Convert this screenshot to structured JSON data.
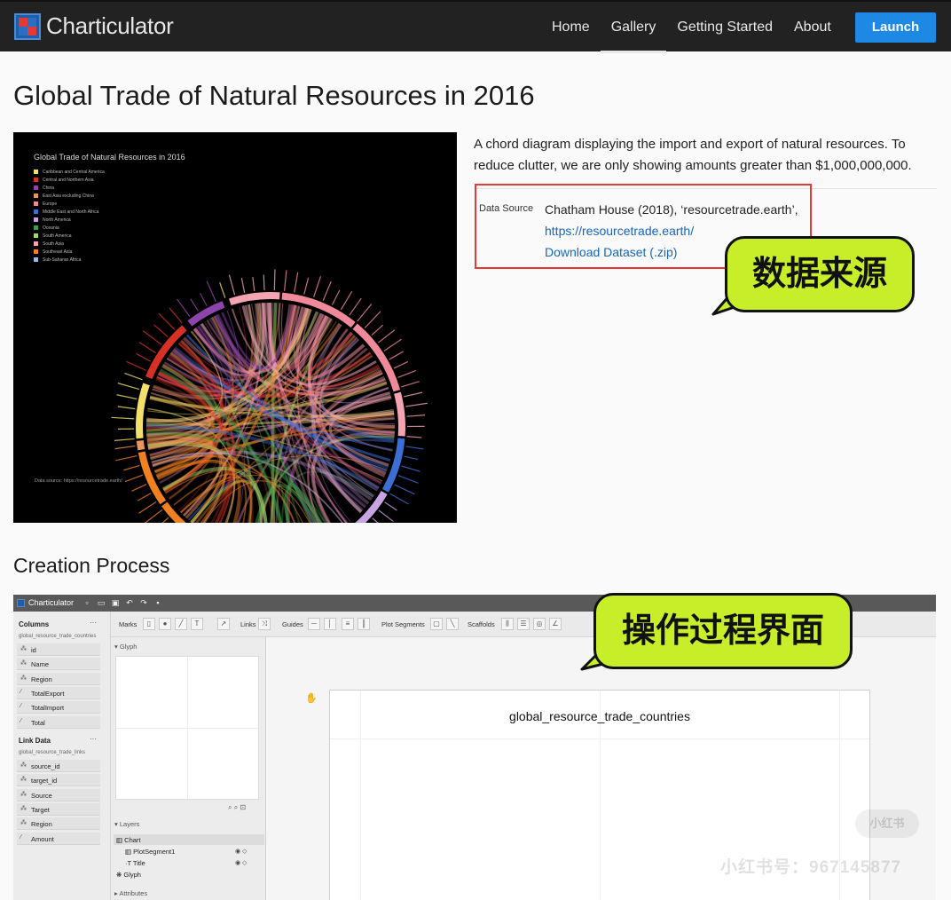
{
  "nav": {
    "brand": "Charticulator",
    "links": [
      "Home",
      "Gallery",
      "Getting Started",
      "About"
    ],
    "active": "Gallery",
    "launch": "Launch",
    "colors": {
      "bar": "#222222",
      "launch": "#1e88e5"
    }
  },
  "page": {
    "title": "Global Trade of Natural Resources in 2016",
    "description": "A chord diagram displaying the import and export of natural resources. To reduce clutter, we are only showing amounts greater than $1,000,000,000.",
    "data_source": {
      "label": "Data Source",
      "value": "Chatham House (2018), ‘resourcetrade.earth’,",
      "link": "https://resourcetrade.earth/",
      "download": "Download Dataset (.zip)"
    },
    "section_title": "Creation Process"
  },
  "annotations": {
    "data_source_callout": "数据来源",
    "process_callout": "操作过程界面",
    "callout_color": "#c8ee2a",
    "highlight_color": "#e53935"
  },
  "preview": {
    "title": "Global Trade of Natural Resources in 2016",
    "legend": [
      {
        "label": "Caribbean and Central America",
        "color": "#f2e06b"
      },
      {
        "label": "Central and Northern Asia",
        "color": "#d73027"
      },
      {
        "label": "China",
        "color": "#8e44ad"
      },
      {
        "label": "East Asia excluding China",
        "color": "#e8965c"
      },
      {
        "label": "Europe",
        "color": "#f08a9a"
      },
      {
        "label": "Middle East and North Africa",
        "color": "#3b6fd6"
      },
      {
        "label": "North America",
        "color": "#c9a4e4"
      },
      {
        "label": "Oceania",
        "color": "#3aa04a"
      },
      {
        "label": "South America",
        "color": "#a6d96a"
      },
      {
        "label": "South Asia",
        "color": "#f4a3b3"
      },
      {
        "label": "Southeast Asia",
        "color": "#f08020"
      },
      {
        "label": "Sub-Saharan Africa",
        "color": "#9bbbe8"
      }
    ],
    "source": "Data source: https://resourcetrade.earth/"
  },
  "app": {
    "title": "Charticulator",
    "toolbar": {
      "marks": "Marks",
      "links": "Links",
      "guides": "Guides",
      "plot_segments": "Plot Segments",
      "scaffolds": "Scaffolds"
    },
    "columns_head": "Columns",
    "columns_table": "global_resource_trade_countries",
    "columns": [
      {
        "name": "id",
        "icon": "categorical-icon"
      },
      {
        "name": "Name",
        "icon": "categorical-icon"
      },
      {
        "name": "Region",
        "icon": "categorical-icon"
      },
      {
        "name": "TotalExport",
        "icon": "numeric-icon"
      },
      {
        "name": "TotalImport",
        "icon": "numeric-icon"
      },
      {
        "name": "Total",
        "icon": "numeric-icon"
      }
    ],
    "links_head": "Link Data",
    "links_table": "global_resource_trade_links",
    "link_columns": [
      {
        "name": "source_id",
        "icon": "categorical-icon"
      },
      {
        "name": "target_id",
        "icon": "categorical-icon"
      },
      {
        "name": "Source",
        "icon": "categorical-icon"
      },
      {
        "name": "Target",
        "icon": "categorical-icon"
      },
      {
        "name": "Region",
        "icon": "categorical-icon"
      },
      {
        "name": "Amount",
        "icon": "numeric-icon"
      }
    ],
    "glyph_head": "Glyph",
    "layers_head": "Layers",
    "layers": [
      "Chart",
      "PlotSegment1",
      "Title",
      "Glyph"
    ],
    "attributes_head": "Attributes",
    "canvas_title": "global_resource_trade_countries"
  },
  "watermark": {
    "logo": "小红书",
    "text": "小红书号：967145877"
  }
}
